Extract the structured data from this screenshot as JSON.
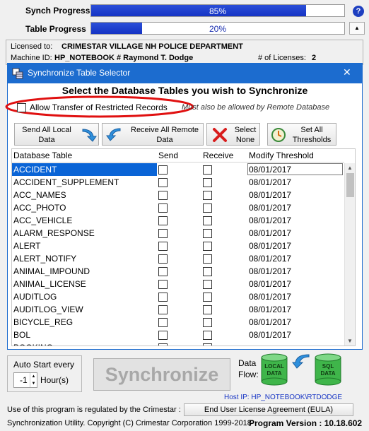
{
  "synch": {
    "label": "Synch Progress",
    "percent": 85,
    "text": "85%"
  },
  "table": {
    "label": "Table Progress",
    "percent": 20,
    "text": "20%"
  },
  "help_label": "?",
  "info": {
    "licensed_to_label": "Licensed to:",
    "licensed_to": "CRIMESTAR VILLAGE NH POLICE DEPARTMENT",
    "machine_label": "Machine ID:",
    "machine_id": "HP_NOTEBOOK # Raymond T. Dodge",
    "licenses_label": "# of Licenses:",
    "licenses": "2"
  },
  "dialog": {
    "title": "Synchronize Table Selector",
    "close_label": "✕",
    "heading": "Select the Database Tables you wish to Synchronize",
    "restricted_label": "Allow Transfer of Restricted Records",
    "restricted_note": "Must also be allowed by Remote Database",
    "buttons": {
      "send_all": [
        "Send All Local",
        "Data"
      ],
      "receive_all": [
        "Receive All Remote",
        "Data"
      ],
      "select_none": [
        "Select",
        "None"
      ],
      "set_thresholds": [
        "Set All",
        "Thresholds"
      ]
    },
    "columns": [
      "Database Table",
      "Send",
      "Receive",
      "Modify Threshold"
    ],
    "rows": [
      {
        "name": "ACCIDENT",
        "date": "08/01/2017"
      },
      {
        "name": "ACCIDENT_SUPPLEMENT",
        "date": "08/01/2017"
      },
      {
        "name": "ACC_NAMES",
        "date": "08/01/2017"
      },
      {
        "name": "ACC_PHOTO",
        "date": "08/01/2017"
      },
      {
        "name": "ACC_VEHICLE",
        "date": "08/01/2017"
      },
      {
        "name": "ALARM_RESPONSE",
        "date": "08/01/2017"
      },
      {
        "name": "ALERT",
        "date": "08/01/2017"
      },
      {
        "name": "ALERT_NOTIFY",
        "date": "08/01/2017"
      },
      {
        "name": "ANIMAL_IMPOUND",
        "date": "08/01/2017"
      },
      {
        "name": "ANIMAL_LICENSE",
        "date": "08/01/2017"
      },
      {
        "name": "AUDITLOG",
        "date": "08/01/2017"
      },
      {
        "name": "AUDITLOG_VIEW",
        "date": "08/01/2017"
      },
      {
        "name": "BICYCLE_REG",
        "date": "08/01/2017"
      },
      {
        "name": "BOL",
        "date": "08/01/2017"
      },
      {
        "name": "BOOKING",
        "date": ""
      }
    ]
  },
  "auto_start": {
    "label": "Auto Start every",
    "value": "-1",
    "unit": "Hour(s)"
  },
  "synchronize_label": "Synchronize",
  "data_flow": {
    "label1": "Data",
    "label2": "Flow:",
    "local": [
      "LOCAL",
      "DATA"
    ],
    "sql": [
      "SQL",
      "DATA"
    ]
  },
  "host_ip": "Host IP: HP_NOTEBOOK\\RTDODGE",
  "footer": {
    "line1": "Use of this program is regulated by the Crimestar :",
    "eula": "End User License Agreement (EULA)",
    "line2": "Synchronization Utility. Copyright (C) Crimestar Corporation 1999-2018",
    "version_label": "Program Version : 10.18.602"
  },
  "colors": {
    "accent": "#1c6ccf",
    "selection": "#0a64d6",
    "progress": "#1533c4",
    "annotation": "#e01010",
    "db_green": "#3fb54a"
  }
}
